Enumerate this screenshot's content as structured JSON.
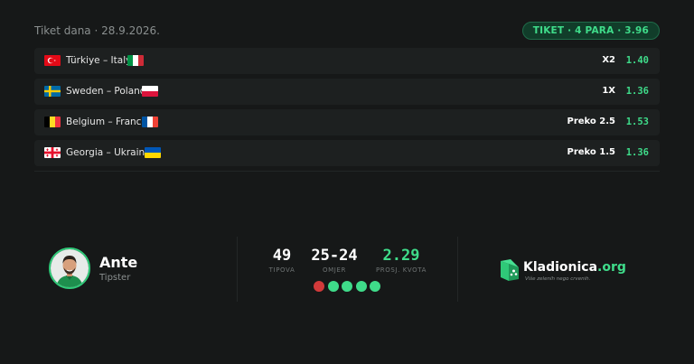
{
  "header": {
    "title": "Tiket dana · 28.9.2026.",
    "ticket_badge": "TIKET · 4 PARA · 3.96"
  },
  "matches": [
    {
      "home_flag": "turkey-flag",
      "away_flag": "italy-flag",
      "name": "Türkiye – Italy",
      "pick": "X2",
      "odds": "1.40"
    },
    {
      "home_flag": "sweden-flag",
      "away_flag": "poland-flag",
      "name": "Sweden – Poland",
      "pick": "1X",
      "odds": "1.36"
    },
    {
      "home_flag": "belgium-flag",
      "away_flag": "france-flag",
      "name": "Belgium – France",
      "pick": "Preko 2.5",
      "odds": "1.53"
    },
    {
      "home_flag": "georgia-flag",
      "away_flag": "ukraine-flag",
      "name": "Georgia – Ukraine",
      "pick": "Preko 1.5",
      "odds": "1.36"
    }
  ],
  "tipster": {
    "name": "Ante",
    "role": "Tipster",
    "avatar_icon": "tipster-avatar"
  },
  "stats": {
    "tips_value": "49",
    "tips_label": "TIPOVA",
    "ratio_value": "25-24",
    "ratio_label": "OMJER",
    "avg_odds_value": "2.29",
    "avg_odds_label": "PROSJ. KVOTA"
  },
  "form_streak": [
    "loss",
    "win",
    "win",
    "win",
    "win"
  ],
  "brand": {
    "name_main": "Kladionica",
    "name_suffix": ".org",
    "tagline": "Više zelenih nego crvenih.",
    "logo_icon": "kladionica-logo-icon"
  },
  "colors": {
    "background": "#161818",
    "row_background": "#1d2020",
    "accent_green": "#3fdc8a",
    "loss_red": "#d23a3a",
    "muted_text": "#8a8f8f"
  }
}
